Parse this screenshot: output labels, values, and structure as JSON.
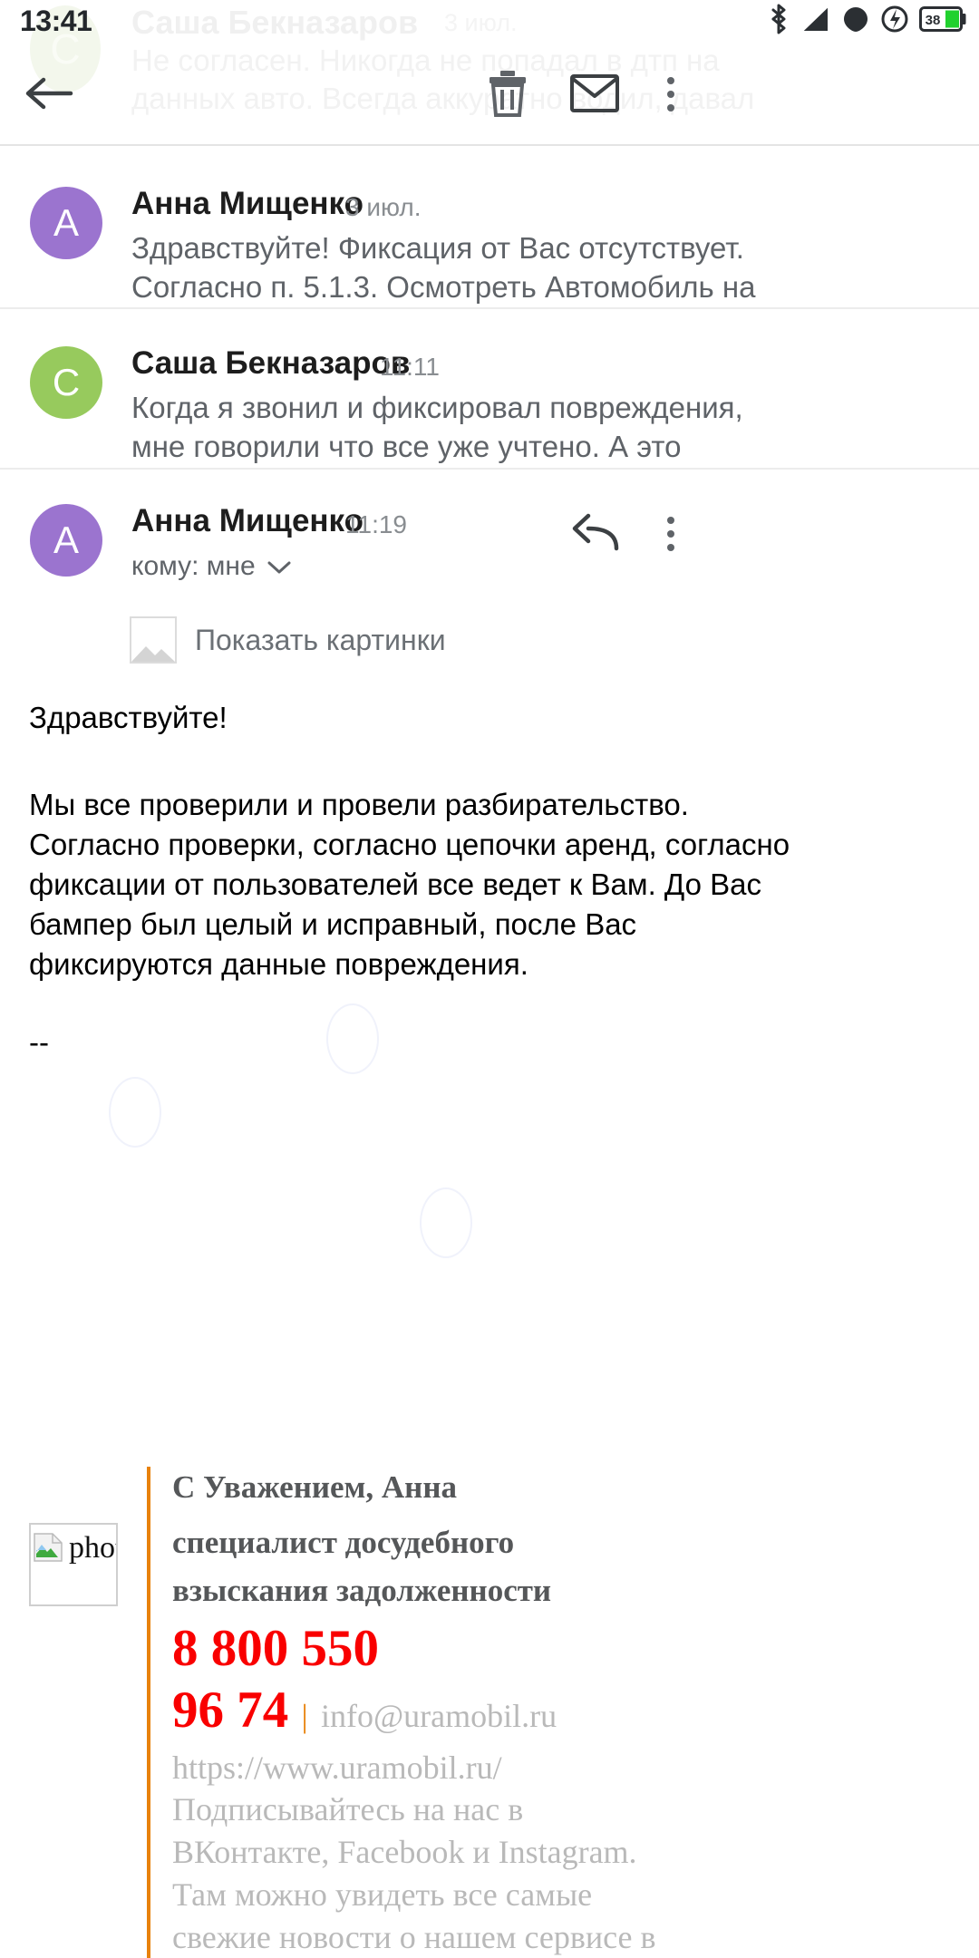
{
  "status_bar": {
    "time": "13:41",
    "battery_percent": "38",
    "icons": [
      "bluetooth-icon",
      "signal-icon",
      "wifi-icon",
      "charging-icon",
      "battery-icon"
    ]
  },
  "toolbar": {
    "back_label": "Назад",
    "delete_label": "Удалить",
    "mail_label": "Пометить как непрочитанное",
    "more_label": "Ещё"
  },
  "ghost": {
    "name": "Саша Бекназаров",
    "date": "3 июл.",
    "line1": "Не согласен. Никогда не попадал в дтп на",
    "line2": "данных авто. Всегда аккуратно водил, давал",
    "avatar_letter": "С"
  },
  "messages": [
    {
      "avatar_letter": "А",
      "avatar_color": "#9b74cf",
      "sender": "Анна Мищенко",
      "time": "3 июл.",
      "snippet_line1": "Здравствуйте! Фиксация от Вас отсутствует.",
      "snippet_line2": "Согласно п. 5.1.3. Осмотреть Автомобиль на"
    },
    {
      "avatar_letter": "С",
      "avatar_color": "#97ca5d",
      "sender": "Саша Бекназаров",
      "time": "11:11",
      "snippet_line1": "Когда я звонил и фиксировал повреждения,",
      "snippet_line2": "мне говорили что все уже учтено. А это"
    }
  ],
  "open_message": {
    "avatar_letter": "А",
    "avatar_color": "#9b74cf",
    "sender": "Анна Мищенко",
    "time": "11:19",
    "recipients": "кому: мне",
    "show_images_label": "Показать картинки",
    "body": {
      "greeting": "Здравствуйте!",
      "para_line1": "Мы все проверили и провели разбирательство.",
      "para_line2": " Согласно проверки, согласно цепочки аренд, согласно",
      "para_line3": "фиксации от пользователей все ведет к Вам. До Вас",
      "para_line4": "бампер был целый и исправный, после Вас",
      "para_line5": "фиксируются данные повреждения.",
      "separator": "--"
    },
    "signature": {
      "image_alt": "photo",
      "line1": "С Уважением, Анна",
      "line2_a": "специалист досудебного",
      "line2_b": "взыскания задолженности",
      "phone_part1": "8 800 550",
      "phone_part2": "96 74",
      "separator": "|",
      "email": "info@uramobil.ru",
      "website": "https://www.uramobil.ru/",
      "social_line1": "Подписывайтесь на нас в",
      "social_line2": "ВКонтакте, Facebook и Instagram.",
      "social_line3": "Там можно увидеть все самые",
      "social_line4": "свежие новости о нашем сервисе в"
    }
  },
  "colors": {
    "accent_orange": "#e8820c",
    "phone_red": "#f90000",
    "avatar_purple": "#9b74cf",
    "avatar_green": "#97ca5d",
    "battery_green": "#21d12e"
  }
}
